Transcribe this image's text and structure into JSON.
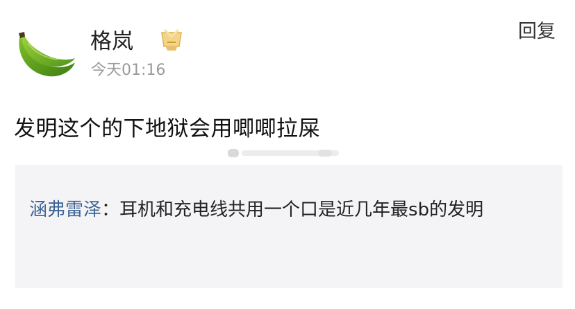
{
  "comment": {
    "user": {
      "name": "格岚",
      "avatar_icon": "green-banana-avatar",
      "badge_icon": "gold-level-badge-icon"
    },
    "timestamp": "今天01:16",
    "reply_label": "回复",
    "text": "发明这个的下地狱会用唧唧拉屎"
  },
  "quote": {
    "author": "涵弗雷泽",
    "separator": "：",
    "text": "耳机和充电线共用一个口是近几年最sb的发明"
  },
  "colors": {
    "author_link": "#3e6594",
    "quote_background": "#f4f4f6",
    "timestamp": "#9a9a9a"
  }
}
